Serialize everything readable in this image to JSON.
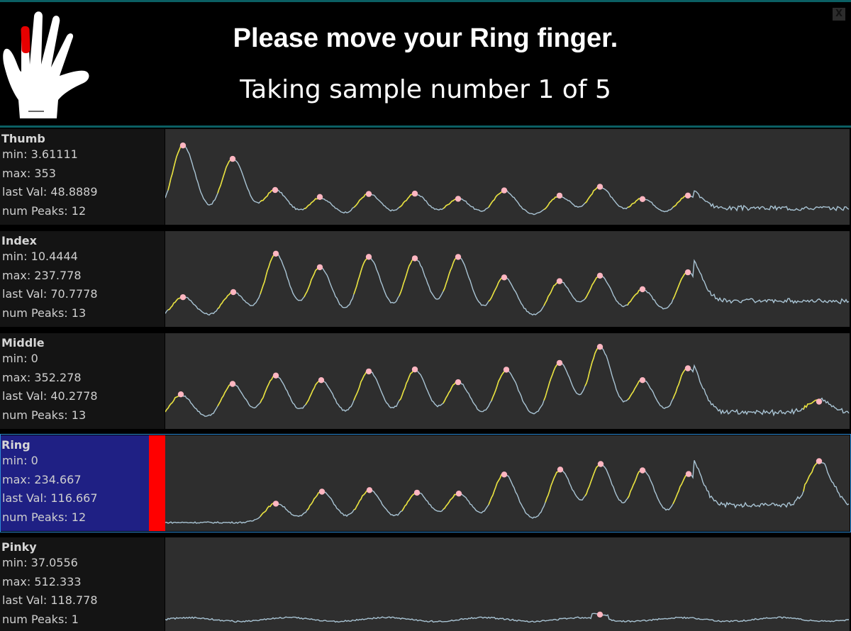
{
  "header": {
    "title": "Please move your Ring finger.",
    "subtitle": "Taking sample number 1 of 5",
    "close_label": "X",
    "hand_icon": "hand-icon",
    "highlighted_finger": "Ring"
  },
  "labels": {
    "min": "min: ",
    "max": "max: ",
    "last": "last Val: ",
    "peaks": "num Peaks: "
  },
  "colors": {
    "line": "#a9c4d4",
    "rising": "#e8e03a",
    "peak": "#ffb6c1",
    "active_panel": "#1f2084",
    "active_indicator": "#ff0000",
    "accent": "#0b5f63"
  },
  "fingers": [
    {
      "name": "Thumb",
      "min": "3.61111",
      "max": "353",
      "last_val": "48.8889",
      "num_peaks": "12",
      "active": false,
      "peaks": [
        25,
        95,
        155,
        218,
        287,
        352,
        413,
        478,
        556,
        613,
        673,
        737
      ]
    },
    {
      "name": "Index",
      "min": "10.4444",
      "max": "237.778",
      "last_val": "70.7778",
      "num_peaks": "13",
      "active": false,
      "peaks": [
        25,
        96,
        156,
        218,
        287,
        352,
        413,
        478,
        556,
        613,
        673,
        737
      ]
    },
    {
      "name": "Middle",
      "min": "0",
      "max": "352.278",
      "last_val": "40.2778",
      "num_peaks": "13",
      "active": false,
      "peaks": [
        22,
        95,
        156,
        220,
        287,
        352,
        413,
        481,
        556,
        613,
        673,
        737,
        922
      ]
    },
    {
      "name": "Ring",
      "min": "0",
      "max": "234.667",
      "last_val": "116.667",
      "num_peaks": "12",
      "active": true,
      "peaks": [
        156,
        221,
        288,
        355,
        414,
        478,
        557,
        614,
        673,
        738,
        922
      ]
    },
    {
      "name": "Pinky",
      "min": "37.0556",
      "max": "512.333",
      "last_val": "118.778",
      "num_peaks": "1",
      "active": false,
      "peaks": [
        613
      ]
    }
  ]
}
